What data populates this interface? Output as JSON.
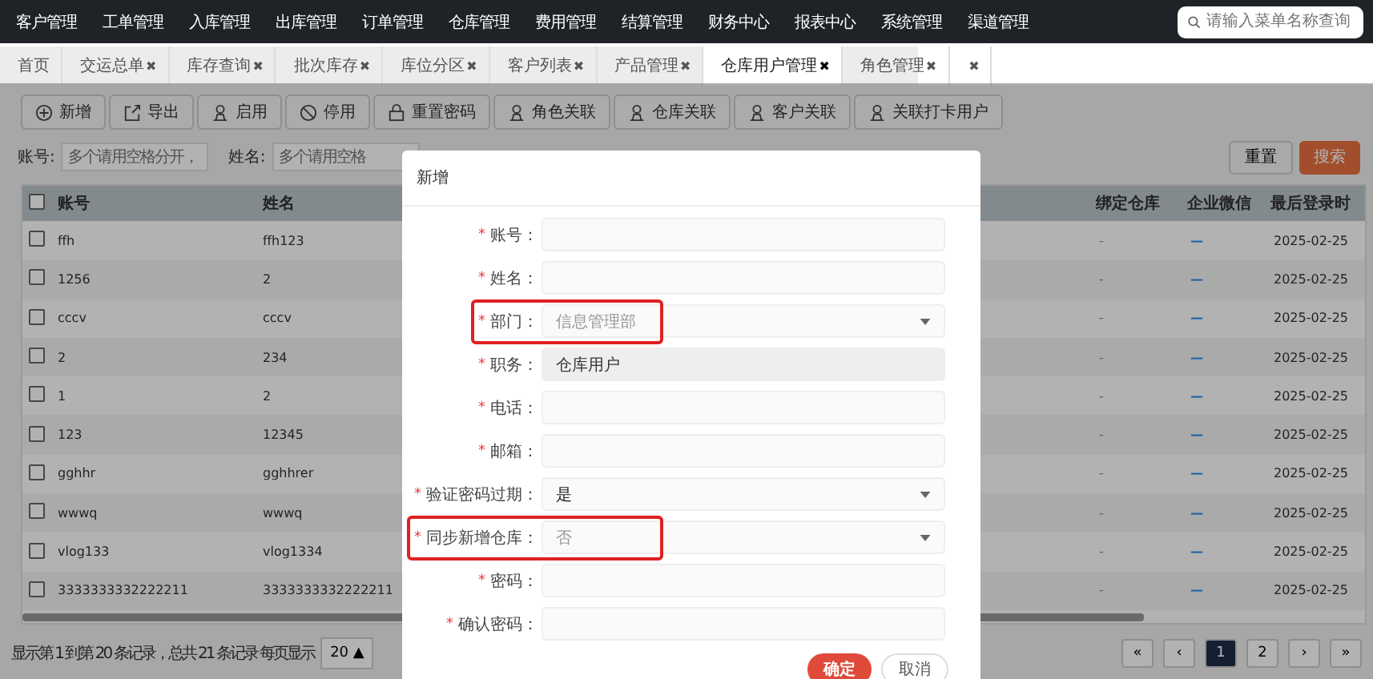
{
  "top_nav": {
    "items": [
      "客户管理",
      "工单管理",
      "入库管理",
      "出库管理",
      "订单管理",
      "仓库管理",
      "费用管理",
      "结算管理",
      "财务中心",
      "报表中心",
      "系统管理",
      "渠道管理"
    ],
    "search": {
      "placeholder": "请输入菜单名称查询"
    }
  },
  "tabs": [
    {
      "label": "首页",
      "closable": false,
      "selected": false
    },
    {
      "label": "交运总单",
      "closable": true,
      "selected": false
    },
    {
      "label": "库存查询",
      "closable": true,
      "selected": false
    },
    {
      "label": "批次库存",
      "closable": true,
      "selected": false
    },
    {
      "label": "库位分区",
      "closable": true,
      "selected": false
    },
    {
      "label": "客户列表",
      "closable": true,
      "selected": false
    },
    {
      "label": "产品管理",
      "closable": true,
      "selected": false
    },
    {
      "label": "仓库用户管理",
      "closable": true,
      "selected": true
    },
    {
      "label": "角色管理",
      "closable": true,
      "selected": false
    },
    {
      "closable": true,
      "selected": false
    }
  ],
  "close_glyph": "✖",
  "toolbar": [
    "新增",
    "导出",
    "启用",
    "停用",
    "重置密码",
    "角色关联",
    "仓库关联",
    "客户关联",
    "关联打卡用户"
  ],
  "filters": [
    {
      "label": "账号:",
      "placeholder": "多个请用空格分开，"
    },
    {
      "label": "姓名:",
      "placeholder": "多个请用空格"
    }
  ],
  "filter_buttons": {
    "reset": "重置",
    "search": "搜索"
  },
  "table": {
    "select_all_checked": false,
    "columns": [
      "账号",
      "姓名",
      "绑定仓库",
      "企业微信",
      "最后登录时"
    ],
    "rows": [
      {
        "checked": false,
        "cells": [
          "ffh",
          "ffh123",
          "-",
          "—",
          "2025-02-25"
        ]
      },
      {
        "checked": false,
        "cells": [
          "1256",
          "2",
          "-",
          "—",
          "2025-02-25"
        ]
      },
      {
        "checked": false,
        "cells": [
          "cccv",
          "cccv",
          "-",
          "—",
          "2025-02-25"
        ]
      },
      {
        "checked": false,
        "cells": [
          "2",
          "234",
          "-",
          "—",
          "2025-02-25"
        ]
      },
      {
        "checked": false,
        "cells": [
          "1",
          "2",
          "-",
          "—",
          "2025-02-25"
        ]
      },
      {
        "checked": false,
        "cells": [
          "123",
          "12345",
          "-",
          "—",
          "2025-02-25"
        ]
      },
      {
        "checked": false,
        "cells": [
          "gghhr",
          "gghhrer",
          "-",
          "—",
          "2025-02-25"
        ]
      },
      {
        "checked": false,
        "cells": [
          "wwwq",
          "wwwq",
          "-",
          "—",
          "2025-02-25"
        ]
      },
      {
        "checked": false,
        "cells": [
          "vlog133",
          "vlog1334",
          "-",
          "—",
          "2025-02-25"
        ]
      },
      {
        "checked": false,
        "cells": [
          "3333333332222211",
          "3333333332222211",
          "-",
          "—",
          "2025-02-25"
        ]
      }
    ]
  },
  "footer": {
    "summary": "显示第 1 到第 20 条记录，总共 21 条记录 每页显示",
    "page_size": "20 ▲"
  },
  "pagination": [
    {
      "label": "«",
      "selected": false
    },
    {
      "label": "‹",
      "selected": false
    },
    {
      "label": "1",
      "selected": true
    },
    {
      "label": "2",
      "selected": false
    },
    {
      "label": "›",
      "selected": false
    },
    {
      "label": "»",
      "selected": false
    }
  ],
  "dialog": {
    "title": "新增",
    "required_mark": "*",
    "fields": [
      {
        "label": "账号：",
        "kind": "input",
        "required": true,
        "highlighted": false
      },
      {
        "label": "姓名：",
        "kind": "input",
        "required": true,
        "highlighted": false
      },
      {
        "label": "部门：",
        "kind": "select",
        "required": true,
        "highlighted": true,
        "placeholder": "信息管理部"
      },
      {
        "label": "职务：",
        "kind": "readonly",
        "required": true,
        "highlighted": false,
        "value": "仓库用户"
      },
      {
        "label": "电话：",
        "kind": "input",
        "required": true,
        "highlighted": false
      },
      {
        "label": "邮箱：",
        "kind": "input",
        "required": true,
        "highlighted": false
      },
      {
        "label": "验证密码过期：",
        "kind": "select",
        "required": true,
        "highlighted": false,
        "value": "是"
      },
      {
        "label": "同步新增仓库：",
        "kind": "select",
        "required": true,
        "highlighted": true,
        "placeholder": "否"
      },
      {
        "label": "密码：",
        "kind": "input",
        "required": true,
        "highlighted": false
      },
      {
        "label": "确认密码：",
        "kind": "input",
        "required": true,
        "highlighted": false
      }
    ],
    "buttons": {
      "ok": "确定",
      "cancel": "取消"
    }
  }
}
